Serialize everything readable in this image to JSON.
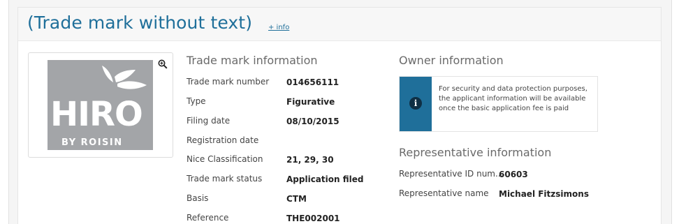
{
  "header": {
    "title": "(Trade mark without text)",
    "more_info_link": "+ info"
  },
  "mark_image": {
    "icon": "trade-mark-logo",
    "text_main": "HIRO",
    "text_sub": "BY ROISIN",
    "zoom_icon": "zoom-in-icon"
  },
  "trade_mark_info": {
    "heading": "Trade mark information",
    "rows": [
      {
        "label": "Trade mark number",
        "value": "014656111"
      },
      {
        "label": "Type",
        "value": "Figurative"
      },
      {
        "label": "Filing date",
        "value": "08/10/2015"
      },
      {
        "label": "Registration date",
        "value": ""
      },
      {
        "label": "Nice Classification",
        "value": "21, 29, 30"
      },
      {
        "label": "Trade mark status",
        "value": "Application filed"
      },
      {
        "label": "Basis",
        "value": "CTM"
      },
      {
        "label": "Reference",
        "value": "THE002001"
      }
    ]
  },
  "owner_info": {
    "heading": "Owner information",
    "icon": "info-icon",
    "notice": "For security and data protection purposes, the applicant information will be available once the basic application fee is paid"
  },
  "representative_info": {
    "heading": "Representative information",
    "rows": [
      {
        "label": "Representative ID num...",
        "value": "60603"
      },
      {
        "label": "Representative name",
        "value": "Michael Fitzsimons"
      }
    ]
  },
  "colors": {
    "accent": "#1f6f9a",
    "info_icon_bg": "#0f2f44",
    "image_bg": "#a3a5a8"
  }
}
